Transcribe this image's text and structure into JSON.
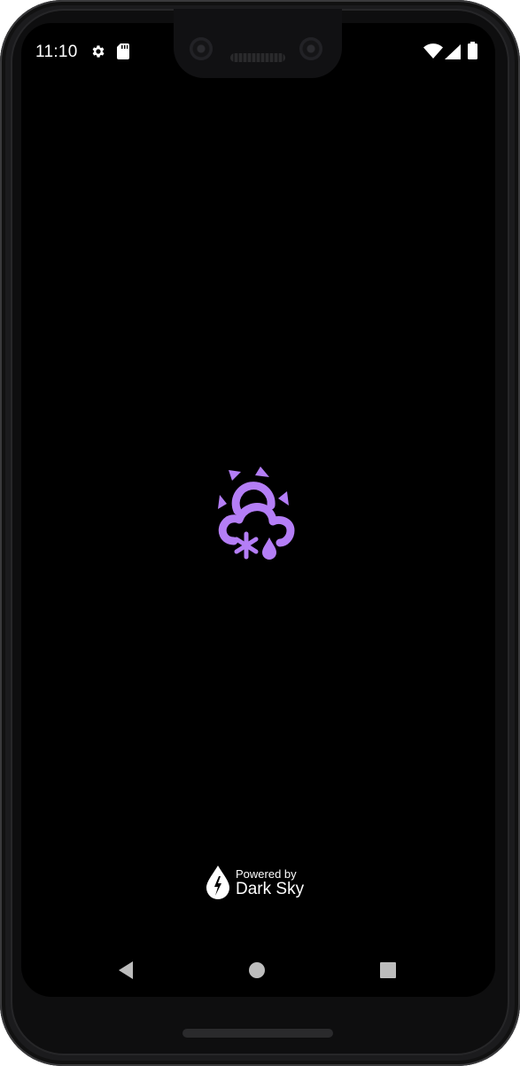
{
  "status_bar": {
    "time": "11:10",
    "left_icons": [
      "settings-gear-icon",
      "sd-card-icon"
    ],
    "right_icons": [
      "wifi-icon",
      "cellular-signal-icon",
      "battery-icon"
    ]
  },
  "splash": {
    "logo_icon": "weather-sun-cloud-snow-rain-icon",
    "logo_color": "#b47ef6",
    "background_color": "#000000",
    "powered_by": {
      "line1": "Powered by",
      "line2": "Dark Sky",
      "icon": "dark-sky-lightning-drop-icon"
    }
  },
  "nav_bar": {
    "buttons": [
      "back-icon",
      "home-icon",
      "recents-icon"
    ]
  }
}
